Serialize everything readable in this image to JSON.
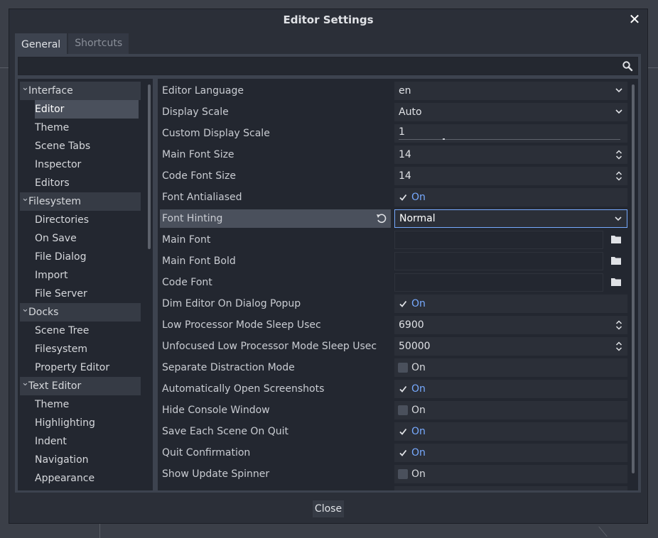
{
  "dialog": {
    "title": "Editor Settings",
    "close_icon": "close-icon",
    "close_label": "Close"
  },
  "tabs": [
    {
      "label": "General",
      "active": true
    },
    {
      "label": "Shortcuts",
      "active": false
    }
  ],
  "search": {
    "placeholder": "",
    "icon": "search-icon"
  },
  "sections": [
    {
      "label": "Interface",
      "items": [
        "Editor",
        "Theme",
        "Scene Tabs",
        "Inspector",
        "Editors"
      ]
    },
    {
      "label": "Filesystem",
      "items": [
        "Directories",
        "On Save",
        "File Dialog",
        "Import",
        "File Server"
      ]
    },
    {
      "label": "Docks",
      "items": [
        "Scene Tree",
        "Filesystem",
        "Property Editor"
      ]
    },
    {
      "label": "Text Editor",
      "items": [
        "Theme",
        "Highlighting",
        "Indent",
        "Navigation",
        "Appearance"
      ]
    }
  ],
  "selected_item": "Editor",
  "properties": [
    {
      "label": "Editor Language",
      "type": "dropdown",
      "value": "en"
    },
    {
      "label": "Display Scale",
      "type": "dropdown",
      "value": "Auto"
    },
    {
      "label": "Custom Display Scale",
      "type": "slider",
      "value": "1"
    },
    {
      "label": "Main Font Size",
      "type": "spin",
      "value": "14"
    },
    {
      "label": "Code Font Size",
      "type": "spin",
      "value": "14"
    },
    {
      "label": "Font Antialiased",
      "type": "check",
      "checked": true,
      "value": "On"
    },
    {
      "label": "Font Hinting",
      "type": "dropdown",
      "value": "Normal",
      "highlighted": true
    },
    {
      "label": "Main Font",
      "type": "path",
      "value": ""
    },
    {
      "label": "Main Font Bold",
      "type": "path",
      "value": ""
    },
    {
      "label": "Code Font",
      "type": "path",
      "value": ""
    },
    {
      "label": "Dim Editor On Dialog Popup",
      "type": "check",
      "checked": true,
      "value": "On"
    },
    {
      "label": "Low Processor Mode Sleep Usec",
      "type": "spin",
      "value": "6900"
    },
    {
      "label": "Unfocused Low Processor Mode Sleep Usec",
      "type": "spin",
      "value": "50000"
    },
    {
      "label": "Separate Distraction Mode",
      "type": "check",
      "checked": false,
      "value": "On"
    },
    {
      "label": "Automatically Open Screenshots",
      "type": "check",
      "checked": true,
      "value": "On"
    },
    {
      "label": "Hide Console Window",
      "type": "check",
      "checked": false,
      "value": "On"
    },
    {
      "label": "Save Each Scene On Quit",
      "type": "check",
      "checked": true,
      "value": "On"
    },
    {
      "label": "Quit Confirmation",
      "type": "check",
      "checked": true,
      "value": "On"
    },
    {
      "label": "Show Update Spinner",
      "type": "check",
      "checked": false,
      "value": "On"
    }
  ],
  "colors": {
    "accent": "#77aaff",
    "panel": "#3d434f",
    "field": "#232730"
  }
}
